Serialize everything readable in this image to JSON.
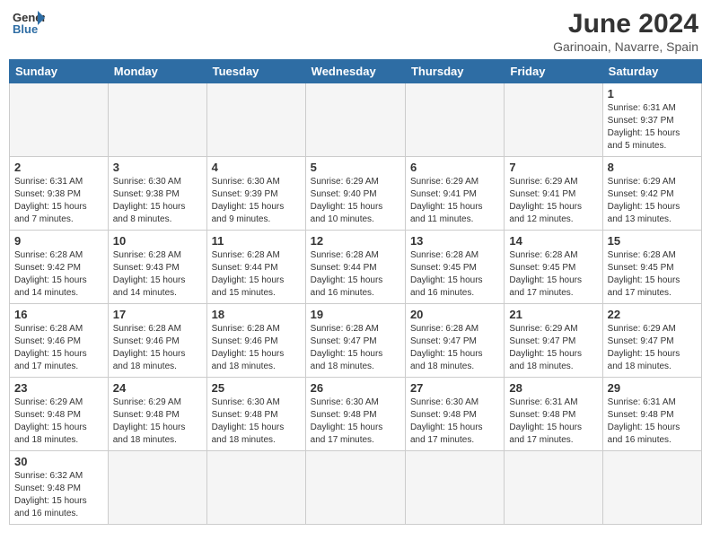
{
  "header": {
    "logo_general": "General",
    "logo_blue": "Blue",
    "title": "June 2024",
    "subtitle": "Garinoain, Navarre, Spain"
  },
  "weekdays": [
    "Sunday",
    "Monday",
    "Tuesday",
    "Wednesday",
    "Thursday",
    "Friday",
    "Saturday"
  ],
  "weeks": [
    [
      {
        "day": "",
        "info": ""
      },
      {
        "day": "",
        "info": ""
      },
      {
        "day": "",
        "info": ""
      },
      {
        "day": "",
        "info": ""
      },
      {
        "day": "",
        "info": ""
      },
      {
        "day": "",
        "info": ""
      },
      {
        "day": "1",
        "info": "Sunrise: 6:31 AM\nSunset: 9:37 PM\nDaylight: 15 hours\nand 5 minutes."
      }
    ],
    [
      {
        "day": "2",
        "info": "Sunrise: 6:31 AM\nSunset: 9:38 PM\nDaylight: 15 hours\nand 7 minutes."
      },
      {
        "day": "3",
        "info": "Sunrise: 6:30 AM\nSunset: 9:38 PM\nDaylight: 15 hours\nand 8 minutes."
      },
      {
        "day": "4",
        "info": "Sunrise: 6:30 AM\nSunset: 9:39 PM\nDaylight: 15 hours\nand 9 minutes."
      },
      {
        "day": "5",
        "info": "Sunrise: 6:29 AM\nSunset: 9:40 PM\nDaylight: 15 hours\nand 10 minutes."
      },
      {
        "day": "6",
        "info": "Sunrise: 6:29 AM\nSunset: 9:41 PM\nDaylight: 15 hours\nand 11 minutes."
      },
      {
        "day": "7",
        "info": "Sunrise: 6:29 AM\nSunset: 9:41 PM\nDaylight: 15 hours\nand 12 minutes."
      },
      {
        "day": "8",
        "info": "Sunrise: 6:29 AM\nSunset: 9:42 PM\nDaylight: 15 hours\nand 13 minutes."
      }
    ],
    [
      {
        "day": "9",
        "info": "Sunrise: 6:28 AM\nSunset: 9:42 PM\nDaylight: 15 hours\nand 14 minutes."
      },
      {
        "day": "10",
        "info": "Sunrise: 6:28 AM\nSunset: 9:43 PM\nDaylight: 15 hours\nand 14 minutes."
      },
      {
        "day": "11",
        "info": "Sunrise: 6:28 AM\nSunset: 9:44 PM\nDaylight: 15 hours\nand 15 minutes."
      },
      {
        "day": "12",
        "info": "Sunrise: 6:28 AM\nSunset: 9:44 PM\nDaylight: 15 hours\nand 16 minutes."
      },
      {
        "day": "13",
        "info": "Sunrise: 6:28 AM\nSunset: 9:45 PM\nDaylight: 15 hours\nand 16 minutes."
      },
      {
        "day": "14",
        "info": "Sunrise: 6:28 AM\nSunset: 9:45 PM\nDaylight: 15 hours\nand 17 minutes."
      },
      {
        "day": "15",
        "info": "Sunrise: 6:28 AM\nSunset: 9:45 PM\nDaylight: 15 hours\nand 17 minutes."
      }
    ],
    [
      {
        "day": "16",
        "info": "Sunrise: 6:28 AM\nSunset: 9:46 PM\nDaylight: 15 hours\nand 17 minutes."
      },
      {
        "day": "17",
        "info": "Sunrise: 6:28 AM\nSunset: 9:46 PM\nDaylight: 15 hours\nand 18 minutes."
      },
      {
        "day": "18",
        "info": "Sunrise: 6:28 AM\nSunset: 9:46 PM\nDaylight: 15 hours\nand 18 minutes."
      },
      {
        "day": "19",
        "info": "Sunrise: 6:28 AM\nSunset: 9:47 PM\nDaylight: 15 hours\nand 18 minutes."
      },
      {
        "day": "20",
        "info": "Sunrise: 6:28 AM\nSunset: 9:47 PM\nDaylight: 15 hours\nand 18 minutes."
      },
      {
        "day": "21",
        "info": "Sunrise: 6:29 AM\nSunset: 9:47 PM\nDaylight: 15 hours\nand 18 minutes."
      },
      {
        "day": "22",
        "info": "Sunrise: 6:29 AM\nSunset: 9:47 PM\nDaylight: 15 hours\nand 18 minutes."
      }
    ],
    [
      {
        "day": "23",
        "info": "Sunrise: 6:29 AM\nSunset: 9:48 PM\nDaylight: 15 hours\nand 18 minutes."
      },
      {
        "day": "24",
        "info": "Sunrise: 6:29 AM\nSunset: 9:48 PM\nDaylight: 15 hours\nand 18 minutes."
      },
      {
        "day": "25",
        "info": "Sunrise: 6:30 AM\nSunset: 9:48 PM\nDaylight: 15 hours\nand 18 minutes."
      },
      {
        "day": "26",
        "info": "Sunrise: 6:30 AM\nSunset: 9:48 PM\nDaylight: 15 hours\nand 17 minutes."
      },
      {
        "day": "27",
        "info": "Sunrise: 6:30 AM\nSunset: 9:48 PM\nDaylight: 15 hours\nand 17 minutes."
      },
      {
        "day": "28",
        "info": "Sunrise: 6:31 AM\nSunset: 9:48 PM\nDaylight: 15 hours\nand 17 minutes."
      },
      {
        "day": "29",
        "info": "Sunrise: 6:31 AM\nSunset: 9:48 PM\nDaylight: 15 hours\nand 16 minutes."
      }
    ],
    [
      {
        "day": "30",
        "info": "Sunrise: 6:32 AM\nSunset: 9:48 PM\nDaylight: 15 hours\nand 16 minutes."
      },
      {
        "day": "",
        "info": ""
      },
      {
        "day": "",
        "info": ""
      },
      {
        "day": "",
        "info": ""
      },
      {
        "day": "",
        "info": ""
      },
      {
        "day": "",
        "info": ""
      },
      {
        "day": "",
        "info": ""
      }
    ]
  ]
}
